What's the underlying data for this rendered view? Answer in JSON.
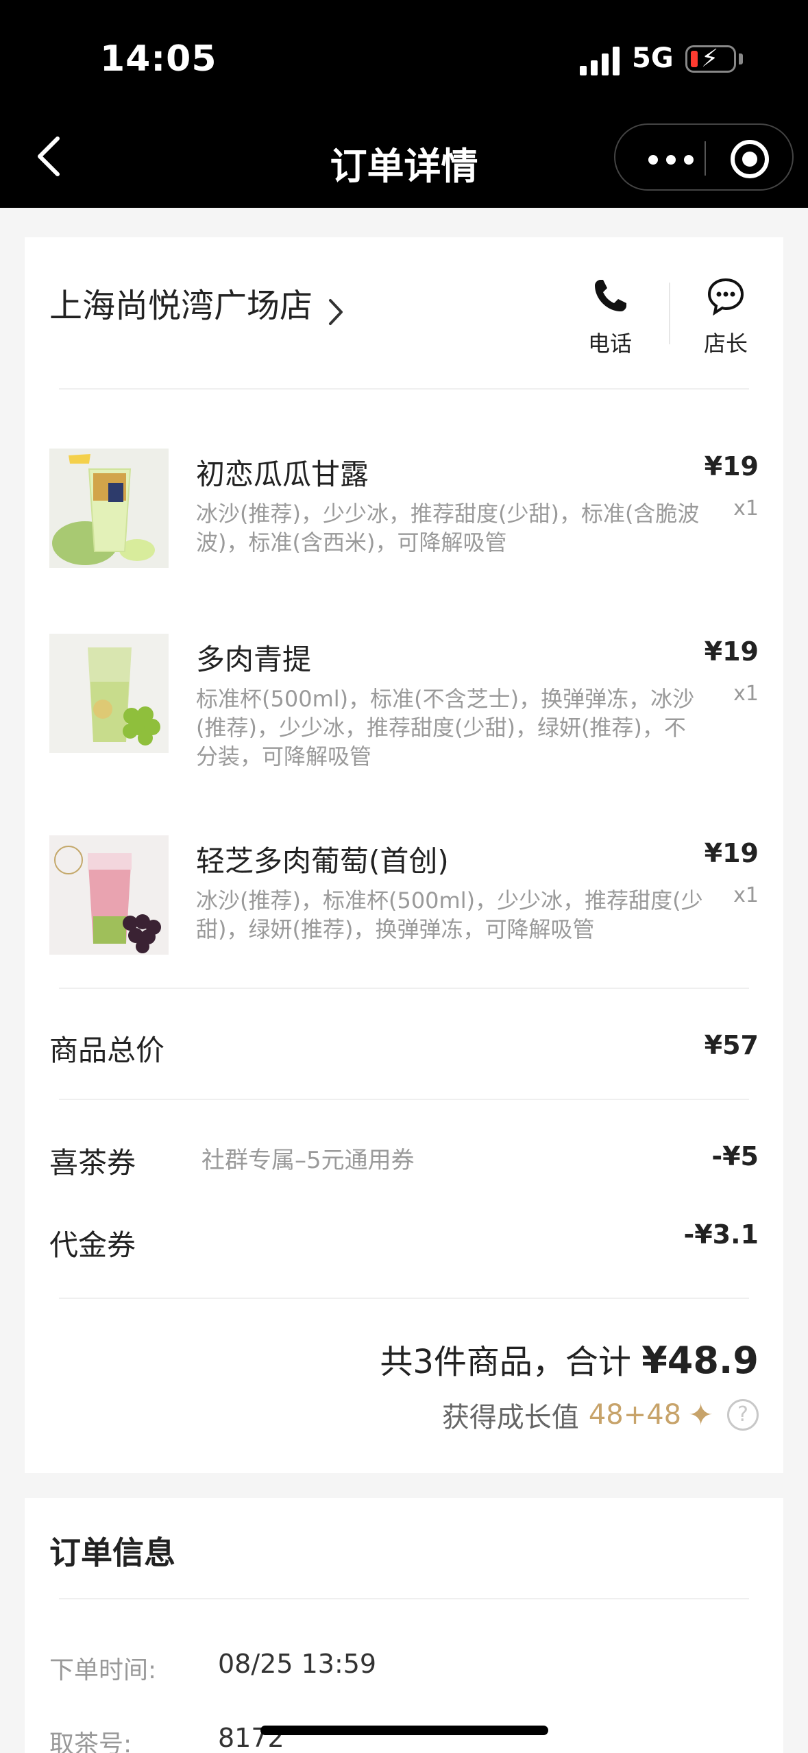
{
  "status_bar": {
    "time": "14:05",
    "network": "5G"
  },
  "nav": {
    "title": "订单详情"
  },
  "store": {
    "name": "上海尚悦湾广场店",
    "phone_label": "电话",
    "manager_label": "店长"
  },
  "items": [
    {
      "name": "初恋瓜瓜甘露",
      "spec": "冰沙(推荐)，少少冰，推荐甜度(少甜)，标准(含脆波波)，标准(含西米)，可降解吸管",
      "price": "¥19",
      "qty": "x1"
    },
    {
      "name": "多肉青提",
      "spec": "标准杯(500ml)，标准(不含芝士)，换弹弹冻，冰沙(推荐)，少少冰，推荐甜度(少甜)，绿妍(推荐)，不分装，可降解吸管",
      "price": "¥19",
      "qty": "x1"
    },
    {
      "name": "轻芝多肉葡萄(首创)",
      "spec": "冰沙(推荐)，标准杯(500ml)，少少冰，推荐甜度(少甜)，绿妍(推荐)，换弹弹冻，可降解吸管",
      "price": "¥19",
      "qty": "x1",
      "badge": "首创"
    }
  ],
  "summary": {
    "goods_total_label": "商品总价",
    "goods_total": "¥57",
    "coupon_label": "喜茶券",
    "coupon_note": "社群专属–5元通用券",
    "coupon_value": "-¥5",
    "voucher_label": "代金券",
    "voucher_value": "-¥3.1",
    "total_prefix": "共3件商品，合计",
    "total_amount": "¥48.9",
    "growth_label": "获得成长值",
    "growth_value": "48+48"
  },
  "order_info": {
    "title": "订单信息",
    "time_label": "下单时间:",
    "time_value": "08/25 13:59",
    "pickup_label": "取茶号:",
    "pickup_value": "8172"
  },
  "colors": {
    "accent": "#c7a36a",
    "battery_low": "#ff3b30"
  }
}
